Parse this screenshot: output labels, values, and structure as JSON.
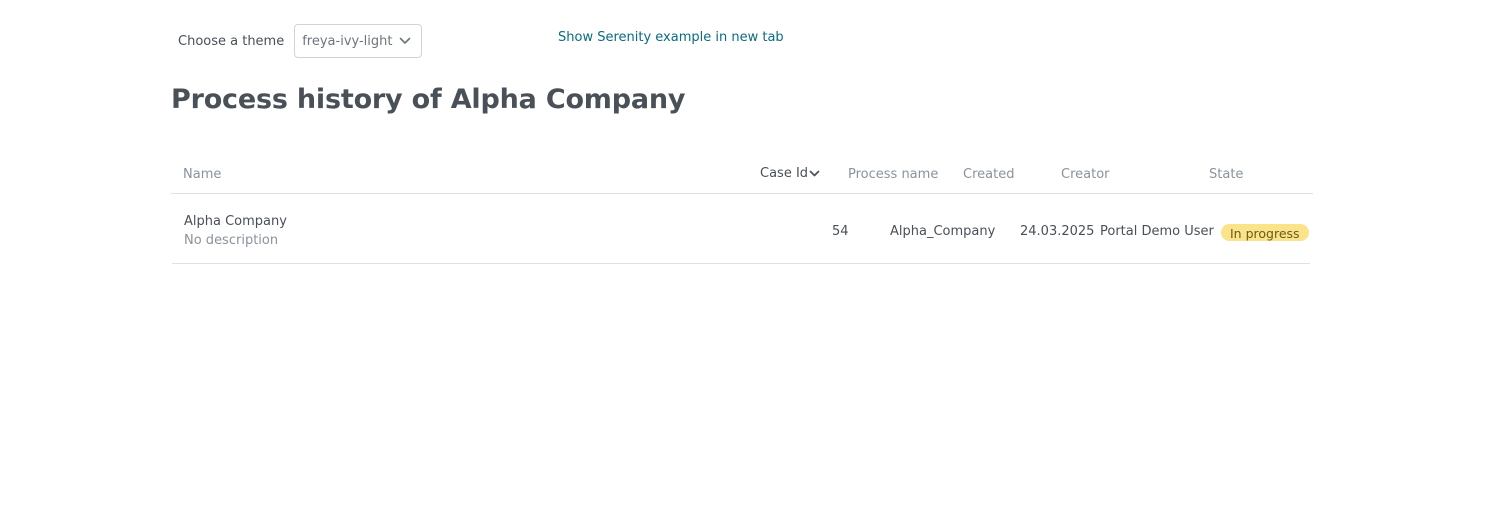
{
  "theme": {
    "label": "Choose a theme",
    "selected": "freya-ivy-light"
  },
  "serenity_link": "Show Serenity example in new tab",
  "page_title": "Process history of Alpha Company",
  "table": {
    "columns": {
      "name": "Name",
      "case_id": "Case Id",
      "process_name": "Process name",
      "created": "Created",
      "creator": "Creator",
      "state": "State"
    },
    "sorted_by": "Case Id",
    "rows": [
      {
        "name": "Alpha Company",
        "description": "No description",
        "case_id": "54",
        "process_name": "Alpha_Company",
        "created": "24.03.2025",
        "creator": "Portal Demo User",
        "state": "In progress"
      }
    ]
  },
  "colors": {
    "link": "#0b6b80",
    "state_in_progress": "#fbe38a",
    "text": "#495057",
    "muted": "#8a939c"
  },
  "icons": {
    "theme_select_caret": "chevron-down-icon",
    "sort_indicator": "sort-down-icon"
  }
}
